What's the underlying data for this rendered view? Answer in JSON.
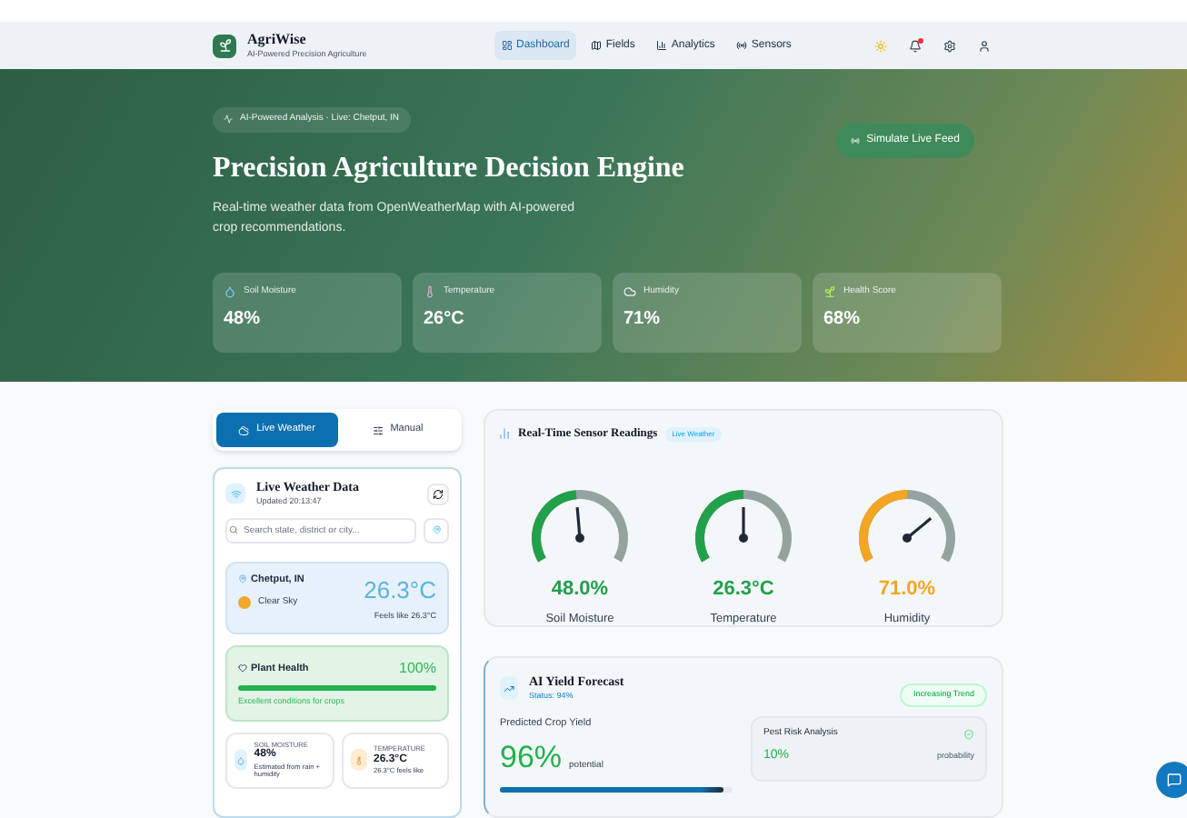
{
  "brand": {
    "name": "AgriWise",
    "tagline": "AI-Powered Precision Agriculture"
  },
  "nav": [
    {
      "label": "Dashboard",
      "selected": true
    },
    {
      "label": "Fields",
      "selected": false
    },
    {
      "label": "Analytics",
      "selected": false
    },
    {
      "label": "Sensors",
      "selected": false
    }
  ],
  "notifications": {
    "unread": true
  },
  "hero": {
    "badge": "AI-Powered Analysis · Live: Chetput, IN",
    "title": "Precision Agriculture Decision Engine",
    "subtitle": "Real-time weather data from OpenWeatherMap with AI-powered crop recommendations.",
    "action": "Simulate Live Feed",
    "stats": [
      {
        "kind": "moisture",
        "label": "Soil Moisture",
        "value": "48%"
      },
      {
        "kind": "temperature",
        "label": "Temperature",
        "value": "26°C"
      },
      {
        "kind": "humidity",
        "label": "Humidity",
        "value": "71%"
      },
      {
        "kind": "health",
        "label": "Health Score",
        "value": "68%"
      }
    ]
  },
  "mode_tabs": [
    {
      "label": "Live Weather",
      "selected": true
    },
    {
      "label": "Manual",
      "selected": false
    }
  ],
  "weather": {
    "title": "Live Weather Data",
    "updated": "Updated 20:13:47",
    "search_placeholder": "Search state, district or city...",
    "location": "Chetput, IN",
    "condition": "Clear Sky",
    "temperature": "26.3°C",
    "feels_like": "Feels like 26.3°C",
    "plant_health": {
      "label": "Plant Health",
      "value": "100%",
      "level": 1.0,
      "note": "Excellent conditions for crops"
    },
    "metrics": [
      {
        "kind": "moisture",
        "label": "SOIL MOISTURE",
        "value": "48%",
        "note": "Estimated from rain + humidity"
      },
      {
        "kind": "temperature",
        "label": "TEMPERATURE",
        "value": "26.3°C",
        "note": "26.3°C feels like"
      }
    ]
  },
  "sensors": {
    "title": "Real-Time Sensor Readings",
    "badge": "Live Weather",
    "gauges": [
      {
        "label": "Soil Moisture",
        "reading": "48.0%",
        "color": "#22a04a"
      },
      {
        "label": "Temperature",
        "reading": "26.3°C",
        "color": "#22a04a"
      },
      {
        "label": "Humidity",
        "reading": "71.0%",
        "color": "#f5a524"
      }
    ]
  },
  "forecast": {
    "title": "AI Yield Forecast",
    "status": "Status: 94%",
    "trend": "Increasing Trend",
    "yield_label": "Predicted Crop Yield",
    "yield_value": "96%",
    "yield_unit": "potential",
    "level": 0.96,
    "pest": {
      "label": "Pest Risk Analysis",
      "value": "10%",
      "unit": "probability"
    }
  }
}
